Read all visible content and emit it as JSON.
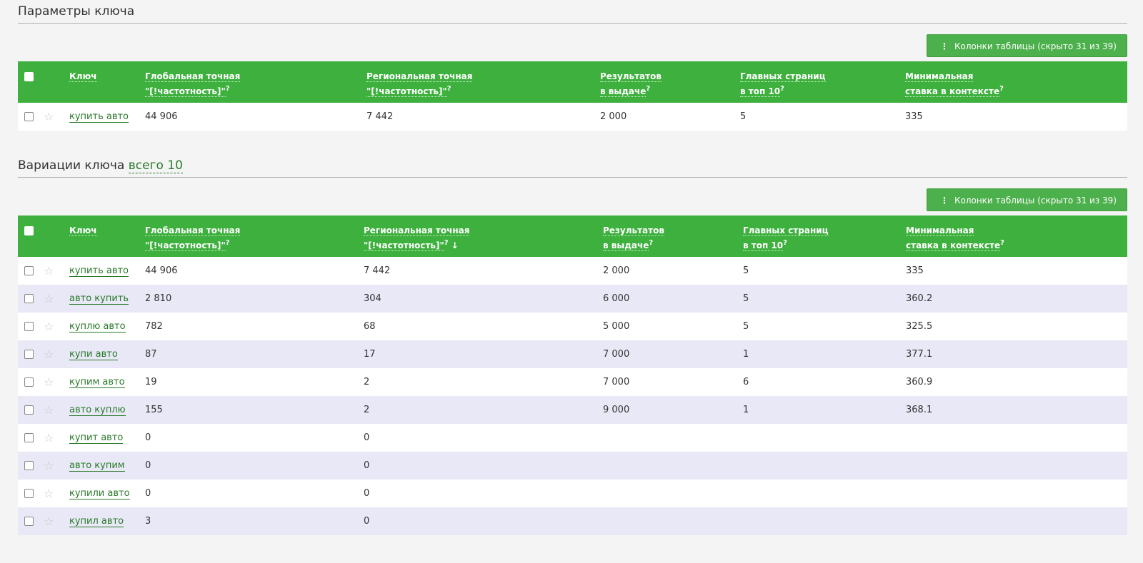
{
  "key_params": {
    "title": "Параметры ключа",
    "columns_button": "Колонки таблицы (скрыто 31 из 39)",
    "headers": {
      "key": "Ключ",
      "global_line1": "Глобальная точная",
      "global_line2": "\"[!частотность]\"",
      "regional_line1": "Региональная точная",
      "regional_line2": "\"[!частотность]\"",
      "results_line1": "Результатов",
      "results_line2": "в выдаче",
      "main_pages_line1": "Главных страниц",
      "main_pages_line2": "в топ 10",
      "min_bid_line1": "Минимальная",
      "min_bid_line2": "ставка в контексте",
      "help_mark": "?"
    },
    "rows": [
      {
        "key": "купить авто",
        "global": "44 906",
        "regional": "7 442",
        "results": "2 000",
        "main_pages": "5",
        "min_bid": "335"
      }
    ]
  },
  "variations": {
    "title": "Вариации ключа",
    "count_link": "всего 10",
    "columns_button": "Колонки таблицы (скрыто 31 из 39)",
    "sort_arrow": "↓",
    "headers": {
      "key": "Ключ",
      "global_line1": "Глобальная точная",
      "global_line2": "\"[!частотность]\"",
      "regional_line1": "Региональная точная",
      "regional_line2": "\"[!частотность]\"",
      "results_line1": "Результатов",
      "results_line2": "в выдаче",
      "main_pages_line1": "Главных страниц",
      "main_pages_line2": "в топ 10",
      "min_bid_line1": "Минимальная",
      "min_bid_line2": "ставка в контексте",
      "help_mark": "?"
    },
    "rows": [
      {
        "key": "купить авто",
        "global": "44 906",
        "regional": "7 442",
        "results": "2 000",
        "main_pages": "5",
        "min_bid": "335"
      },
      {
        "key": "авто купить",
        "global": "2 810",
        "regional": "304",
        "results": "6 000",
        "main_pages": "5",
        "min_bid": "360.2"
      },
      {
        "key": "куплю авто",
        "global": "782",
        "regional": "68",
        "results": "5 000",
        "main_pages": "5",
        "min_bid": "325.5"
      },
      {
        "key": "купи авто",
        "global": "87",
        "regional": "17",
        "results": "7 000",
        "main_pages": "1",
        "min_bid": "377.1"
      },
      {
        "key": "купим авто",
        "global": "19",
        "regional": "2",
        "results": "7 000",
        "main_pages": "6",
        "min_bid": "360.9"
      },
      {
        "key": "авто куплю",
        "global": "155",
        "regional": "2",
        "results": "9 000",
        "main_pages": "1",
        "min_bid": "368.1"
      },
      {
        "key": "купит авто",
        "global": "0",
        "regional": "0",
        "results": "",
        "main_pages": "",
        "min_bid": ""
      },
      {
        "key": "авто купим",
        "global": "0",
        "regional": "0",
        "results": "",
        "main_pages": "",
        "min_bid": ""
      },
      {
        "key": "купили авто",
        "global": "0",
        "regional": "0",
        "results": "",
        "main_pages": "",
        "min_bid": ""
      },
      {
        "key": "купил авто",
        "global": "3",
        "regional": "0",
        "results": "",
        "main_pages": "",
        "min_bid": ""
      }
    ]
  },
  "icons": {
    "star": "☆",
    "columns": "⋮"
  }
}
